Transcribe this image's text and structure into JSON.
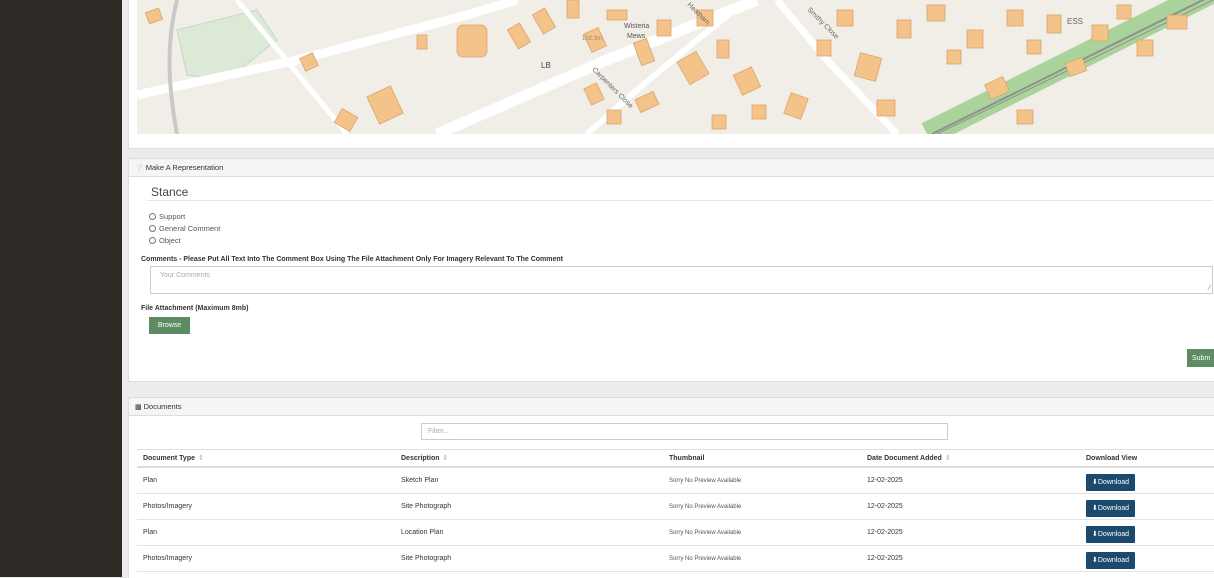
{
  "representation": {
    "panel_title": "Make A Representation",
    "stance_heading": "Stance",
    "options": [
      "Support",
      "General Comment",
      "Object"
    ],
    "comments_label": "Comments - Please Put All Text Into The Comment Box Using The File Attachment Only For Imagery Relevant To The Comment",
    "comments_placeholder": "Your Comments",
    "attachment_label": "File Attachment (Maximum 8mb)",
    "browse_label": "Browse",
    "submit_label": "Subm"
  },
  "map": {
    "labels": [
      "Wisteria",
      "Mews",
      "LB",
      "Carpenters Close",
      "Smithy Close",
      "Heatham",
      "ESS",
      "102.3m"
    ]
  },
  "documents": {
    "panel_title": "Documents",
    "filter_placeholder": "Filter...",
    "columns": [
      "Document Type",
      "Description",
      "Thumbnail",
      "Date Document Added",
      "Download View"
    ],
    "rows": [
      {
        "type": "Plan",
        "description": "Sketch Plan",
        "thumbnail": "Sorry No Preview Available",
        "date": "12-02-2025",
        "action": "Download"
      },
      {
        "type": "Photos/Imagery",
        "description": "Site Photograph",
        "thumbnail": "Sorry No Preview Available",
        "date": "12-02-2025",
        "action": "Download"
      },
      {
        "type": "Plan",
        "description": "Location Plan",
        "thumbnail": "Sorry No Preview Available",
        "date": "12-02-2025",
        "action": "Download"
      },
      {
        "type": "Photos/Imagery",
        "description": "Site Photograph",
        "thumbnail": "Sorry No Preview Available",
        "date": "12-02-2025",
        "action": "Download"
      }
    ]
  }
}
